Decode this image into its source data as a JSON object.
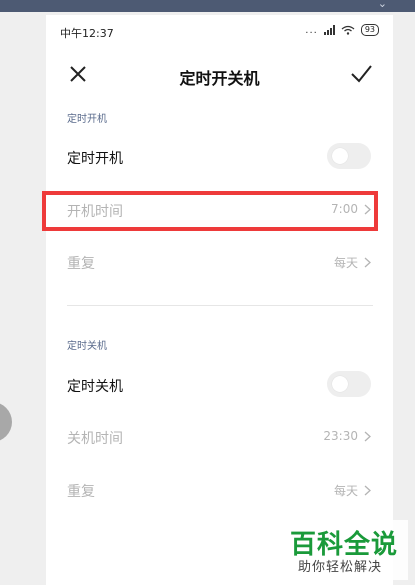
{
  "status_bar": {
    "time": "中午12:37",
    "dots": "...",
    "battery": "93"
  },
  "header": {
    "title": "定时开关机"
  },
  "power_on": {
    "section_label": "定时开机",
    "toggle_label": "定时开机",
    "toggle_on": false,
    "time_label": "开机时间",
    "time_value": "7:00",
    "repeat_label": "重复",
    "repeat_value": "每天"
  },
  "power_off": {
    "section_label": "定时关机",
    "toggle_label": "定时关机",
    "toggle_on": false,
    "time_label": "关机时间",
    "time_value": "23:30",
    "repeat_label": "重复",
    "repeat_value": "每天"
  },
  "watermark": {
    "title": "百科全说",
    "subtitle": "助你轻松解决"
  },
  "colors": {
    "highlight": "#ee3a3a",
    "section_label": "#5a6b8c",
    "watermark_green": "#1a9a3a"
  }
}
